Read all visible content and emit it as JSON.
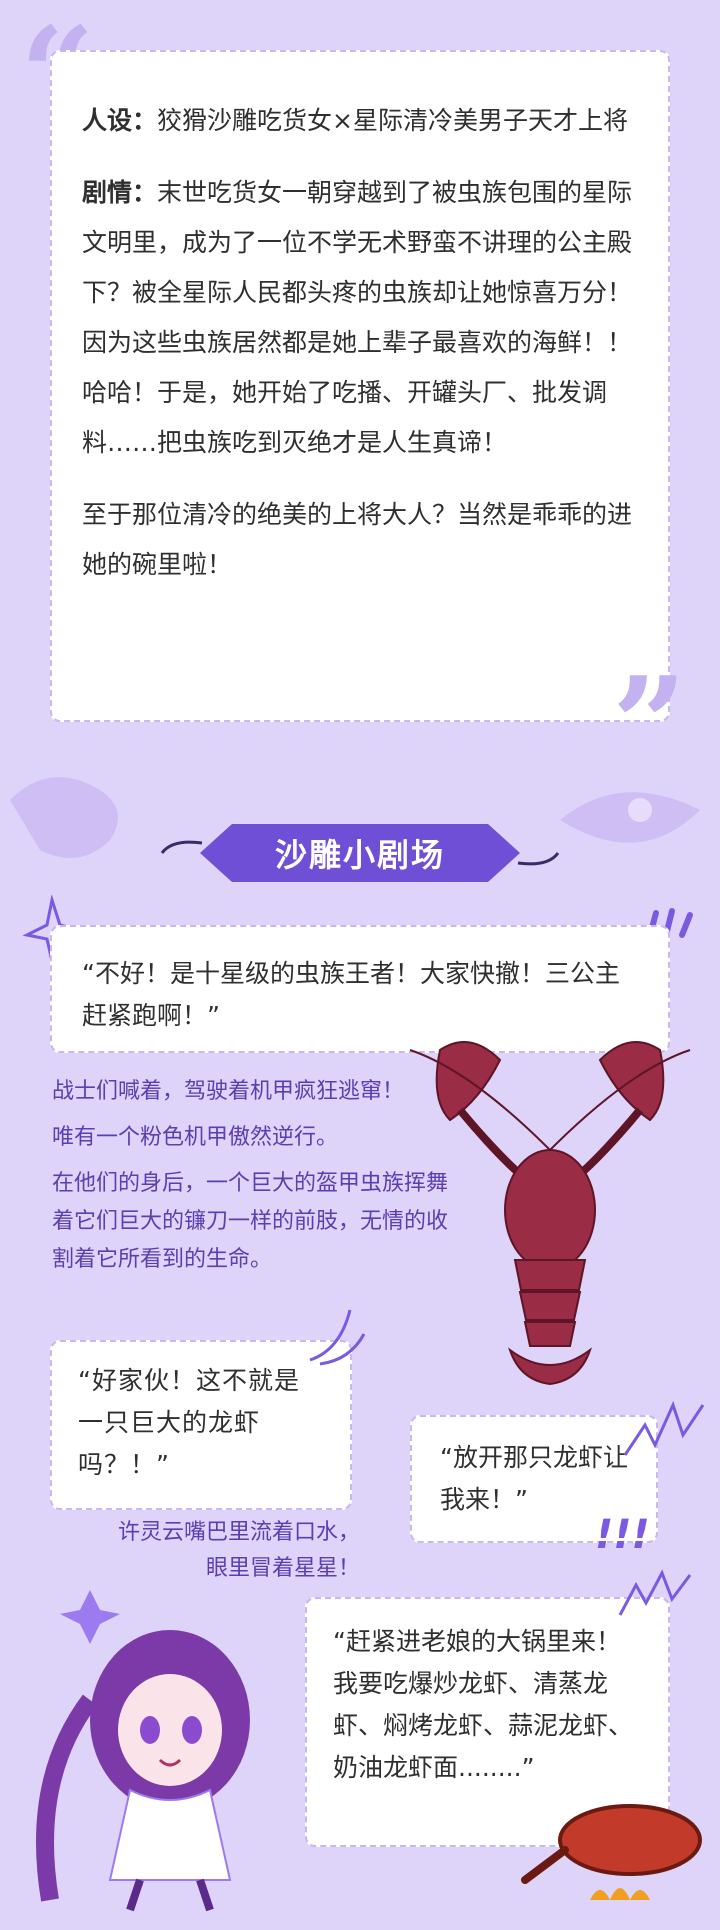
{
  "intro": {
    "persona_label": "人设：",
    "persona_text": "狡猾沙雕吃货女×星际清冷美男子天才上将",
    "plot_label": "剧情：",
    "plot_text": "末世吃货女一朝穿越到了被虫族包围的星际文明里，成为了一位不学无术野蛮不讲理的公主殿下？被全星际人民都头疼的虫族却让她惊喜万分！因为这些虫族居然都是她上辈子最喜欢的海鲜！！哈哈！于是，她开始了吃播、开罐头厂、批发调料……把虫族吃到灭绝才是人生真谛！",
    "ending_text": "至于那位清冷的绝美的上将大人？当然是乖乖的进她的碗里啦！"
  },
  "section_title": "沙雕小剧场",
  "scene": {
    "bubble1": "“不好！是十星级的虫族王者！大家快撤！三公主赶紧跑啊！”",
    "narration1": "战士们喊着，驾驶着机甲疯狂逃窜！",
    "narration2": "唯有一个粉色机甲傲然逆行。",
    "narration3": "在他们的身后，一个巨大的盔甲虫族挥舞着它们巨大的镰刀一样的前肢，无情的收割着它所看到的生命。",
    "bubble2": "“好家伙！这不就是一只巨大的龙虾吗？！”",
    "bubble3": "“放开那只龙虾让我来！”",
    "caption_line1": "许灵云嘴巴里流着口水，",
    "caption_line2": "眼里冒着星星！",
    "bubble4": "“赶紧进老娘的大锅里来！我要吃爆炒龙虾、清蒸龙虾、焖烤龙虾、蒜泥龙虾、奶油龙虾面........”",
    "exclaim": "!!!"
  },
  "colors": {
    "background": "#ded3f9",
    "accent": "#6e4fd6",
    "dashed_border": "#c9b7f2",
    "lobster": "#9a2c45"
  }
}
